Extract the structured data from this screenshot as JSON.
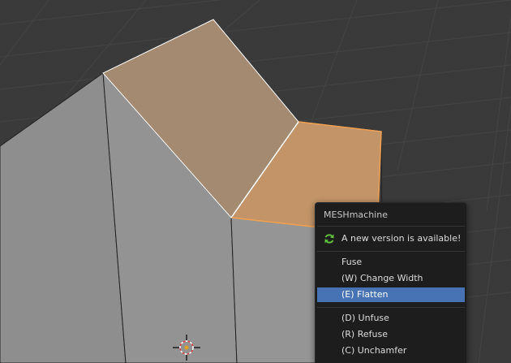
{
  "colors": {
    "background": "#3a3a3a",
    "grid": "#454545",
    "mesh_face": "#8f8f8f",
    "selected_face": "#a78b6f",
    "selected_face_active": "#c49566",
    "selected_edge": "#f0a050",
    "menu_bg": "#1d1d1d",
    "menu_highlight": "#4772b3",
    "update_icon": "#5fbf3a"
  },
  "viewport": {
    "cursor_icon": "3d-cursor-icon"
  },
  "menu": {
    "title": "MESHmachine",
    "update_notice": {
      "icon": "refresh-icon",
      "label": "A new version is available!"
    },
    "items": [
      {
        "label": "Fuse"
      },
      {
        "label": "(W) Change Width"
      },
      {
        "label": "(E) Flatten"
      },
      {
        "label": "(D) Unfuse"
      },
      {
        "label": "(R) Refuse"
      },
      {
        "label": "(C) Unchamfer"
      }
    ]
  }
}
